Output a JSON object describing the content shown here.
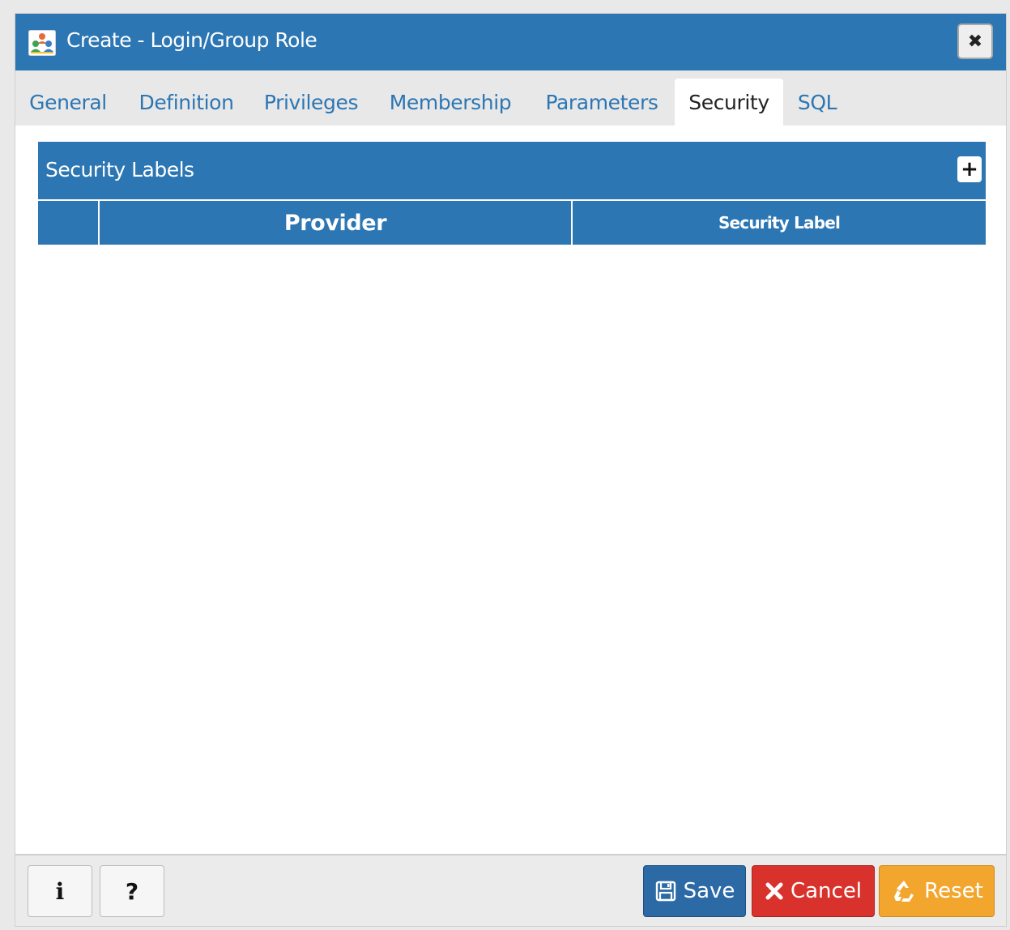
{
  "dialog": {
    "title": "Create - Login/Group Role",
    "close_symbol": "✖"
  },
  "tabs": [
    {
      "label": "General",
      "active": false
    },
    {
      "label": "Definition",
      "active": false
    },
    {
      "label": "Privileges",
      "active": false
    },
    {
      "label": "Membership",
      "active": false
    },
    {
      "label": "Parameters",
      "active": false
    },
    {
      "label": "Security",
      "active": true
    },
    {
      "label": "SQL",
      "active": false
    }
  ],
  "security_labels": {
    "title": "Security Labels",
    "add_symbol": "+",
    "columns": {
      "provider": "Provider",
      "security_label": "Security Label"
    },
    "rows": []
  },
  "footer": {
    "info_label": "i",
    "help_label": "?",
    "save_label": "Save",
    "cancel_label": "Cancel",
    "reset_label": "Reset"
  },
  "colors": {
    "primary": "#2c76b3",
    "save": "#2c6aa6",
    "cancel": "#d9322c",
    "reset": "#f3a62d"
  }
}
